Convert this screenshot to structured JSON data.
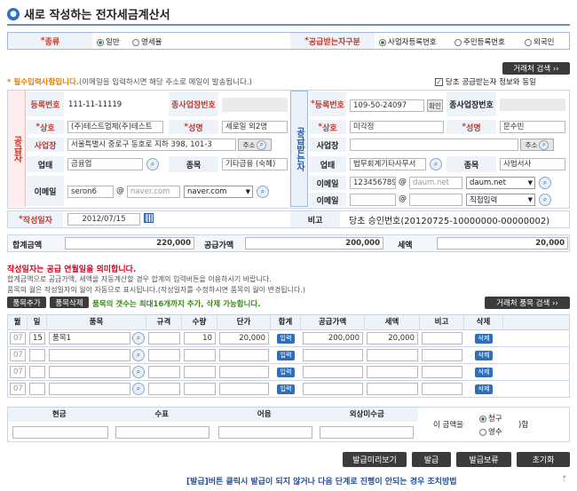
{
  "title": "새로 작성하는 전자세금계산서",
  "type_row": {
    "kind_label": "종류",
    "opt1": "일반",
    "opt2": "영세율",
    "recv_label": "공급받는자구분",
    "r1": "사업자등록번호",
    "r2": "주민등록번호",
    "r3": "외국인"
  },
  "partner_search": "거래처 검색 ››",
  "notice": "* 필수입력사항입니다.",
  "notice2": "(이메일을 입력하시면 해당 주소로 메일이 발송됩니다.)",
  "sync_label": "당초 공급받는자 정보와 동일",
  "supplier": {
    "side": "공급자",
    "reg_label": "등록번호",
    "reg": "111-11-11119",
    "sub_label": "종사업장번호",
    "name_label": "상호",
    "name": "(주)테스트업체(주)테스트",
    "ceo_label": "성명",
    "ceo": "세로일 외2명",
    "addr_label": "사업장",
    "addr": "서울특별시 중로구 동호로 지하 398, 101-3",
    "addr_btn": "주소",
    "biz_label": "업태",
    "biz": "금융업",
    "item_label": "종목",
    "item": "기타금융 (숙혜)",
    "email_label": "이메일",
    "email_id": "seron6",
    "email_dom": "naver.com",
    "email_sel": "naver.com"
  },
  "buyer": {
    "side": "공급받는자",
    "reg_label": "등록번호",
    "reg": "109-50-24097",
    "confirm": "확인",
    "sub_label": "종사업장번호",
    "name_label": "상호",
    "name": "미각정",
    "ceo_label": "성명",
    "ceo": "문수빈",
    "addr_label": "사업장",
    "addr": "",
    "addr_btn": "주소",
    "biz_label": "업태",
    "biz": "법무회계기타사무서",
    "item_label": "종목",
    "item": "사법서사",
    "email_label": "이메일",
    "email_id": "123456789C",
    "email_dom": "daum.net",
    "email_sel": "daum.net",
    "email2_label": "이메일",
    "email2_sel": "직접입력"
  },
  "date_label": "작성일자",
  "date": "2012/07/15",
  "note_label": "비고",
  "note": "당초 승인번호(20120725-10000000-00000002)",
  "totals": {
    "sum_label": "합계금액",
    "sum": "220,000",
    "supply_label": "공급가액",
    "supply": "200,000",
    "tax_label": "세액",
    "tax": "20,000"
  },
  "warn1": "작성일자는 공급 연월일을 의미합니다.",
  "warn2": "합계금액으로 공급가액, 세액을 자동계산할 경우 합계의 입력버튼을 이용하시기 바랍니다.",
  "warn3": "품목의 월은 작성일자의 월이 자동으로 표시됩니다.(작성일자를 수정하시면 품목의 월이 변경됩니다.)",
  "add_item": "품목추가",
  "del_item": "품목삭제",
  "item_notice": "품목의 갯수는 최대16개까지 추가, 삭제 가능합니다.",
  "item_search": "거래처 품목 검색 ››",
  "cols": [
    "월",
    "일",
    "품목",
    "규격",
    "수량",
    "단가",
    "합계",
    "공급가액",
    "세액",
    "비고",
    "삭제"
  ],
  "rows": [
    {
      "m": "07",
      "d": "15",
      "item": "품목1",
      "spec": "",
      "qty": "10",
      "price": "20,000",
      "sum_btn": "입력",
      "supply": "200,000",
      "tax": "20,000",
      "note": "",
      "del": "삭제"
    },
    {
      "m": "07",
      "d": "",
      "item": "",
      "spec": "",
      "qty": "",
      "price": "",
      "sum_btn": "입력",
      "supply": "",
      "tax": "",
      "note": "",
      "del": "삭제"
    },
    {
      "m": "07",
      "d": "",
      "item": "",
      "spec": "",
      "qty": "",
      "price": "",
      "sum_btn": "입력",
      "supply": "",
      "tax": "",
      "note": "",
      "del": "삭제"
    },
    {
      "m": "07",
      "d": "",
      "item": "",
      "spec": "",
      "qty": "",
      "price": "",
      "sum_btn": "입력",
      "supply": "",
      "tax": "",
      "note": "",
      "del": "삭제"
    }
  ],
  "pay": {
    "cash": "현금",
    "check": "수표",
    "bill": "어음",
    "credit": "외상미수금",
    "amount_label": "이 금액을",
    "claim": "청구",
    "receipt": "영수",
    "suffix": "함"
  },
  "buttons": {
    "preview": "발급미리보기",
    "issue": "발급",
    "hold": "발급보류",
    "reset": "초기화"
  },
  "footer": "[발급]버튼 클릭시 발급이 되지 않거나 다음 단계로 진행이 안되는 경우 조치방법"
}
